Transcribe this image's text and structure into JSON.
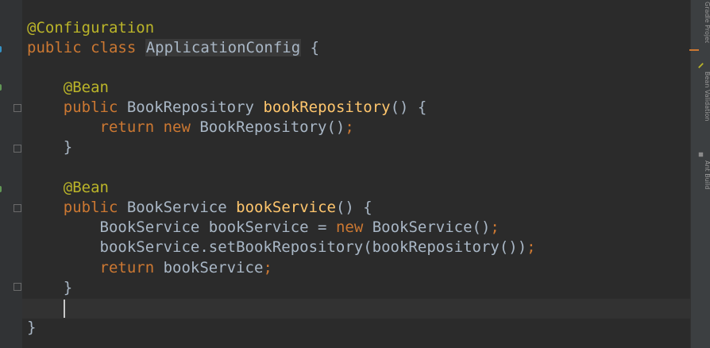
{
  "editor": {
    "lines": [
      {
        "tokens": [
          {
            "t": "@Configuration",
            "c": "ann"
          }
        ]
      },
      {
        "tokens": [
          {
            "t": "public class ",
            "c": "kw"
          },
          {
            "t": "ApplicationConfig",
            "c": "hl"
          },
          {
            "t": " {",
            "c": ""
          }
        ]
      },
      {
        "tokens": []
      },
      {
        "tokens": [
          {
            "t": "    @Bean",
            "c": "ann"
          }
        ]
      },
      {
        "tokens": [
          {
            "t": "    public ",
            "c": "kw"
          },
          {
            "t": "BookRepository ",
            "c": ""
          },
          {
            "t": "bookRepository",
            "c": "fn"
          },
          {
            "t": "() {",
            "c": ""
          }
        ]
      },
      {
        "tokens": [
          {
            "t": "        return new ",
            "c": "kw"
          },
          {
            "t": "BookRepository()",
            "c": ""
          },
          {
            "t": ";",
            "c": "kw"
          }
        ]
      },
      {
        "tokens": [
          {
            "t": "    }",
            "c": ""
          }
        ]
      },
      {
        "tokens": []
      },
      {
        "tokens": [
          {
            "t": "    @Bean",
            "c": "ann"
          }
        ]
      },
      {
        "tokens": [
          {
            "t": "    public ",
            "c": "kw"
          },
          {
            "t": "BookService ",
            "c": ""
          },
          {
            "t": "bookService",
            "c": "fn"
          },
          {
            "t": "() {",
            "c": ""
          }
        ]
      },
      {
        "tokens": [
          {
            "t": "        BookService bookService = ",
            "c": ""
          },
          {
            "t": "new ",
            "c": "kw"
          },
          {
            "t": "BookService()",
            "c": ""
          },
          {
            "t": ";",
            "c": "kw"
          }
        ]
      },
      {
        "tokens": [
          {
            "t": "        bookService.setBookRepository(bookRepository())",
            "c": ""
          },
          {
            "t": ";",
            "c": "kw"
          }
        ]
      },
      {
        "tokens": [
          {
            "t": "        return ",
            "c": "kw"
          },
          {
            "t": "bookService",
            "c": ""
          },
          {
            "t": ";",
            "c": "kw"
          }
        ]
      },
      {
        "tokens": [
          {
            "t": "    }",
            "c": ""
          }
        ]
      },
      {
        "tokens": []
      },
      {
        "tokens": [
          {
            "t": "}",
            "c": ""
          }
        ]
      }
    ]
  },
  "sidebar": {
    "tabs": [
      {
        "label": "Gradle Projects",
        "icon": "gradle-icon"
      },
      {
        "label": "Bean Validation",
        "icon": "bean-validation-icon"
      },
      {
        "label": "Ant Build",
        "icon": "ant-build-icon"
      }
    ]
  },
  "colors": {
    "background": "#2b2b2b",
    "keyword": "#cc7832",
    "annotation": "#bbb529",
    "method": "#ffc66d",
    "text": "#a9b7c6"
  }
}
